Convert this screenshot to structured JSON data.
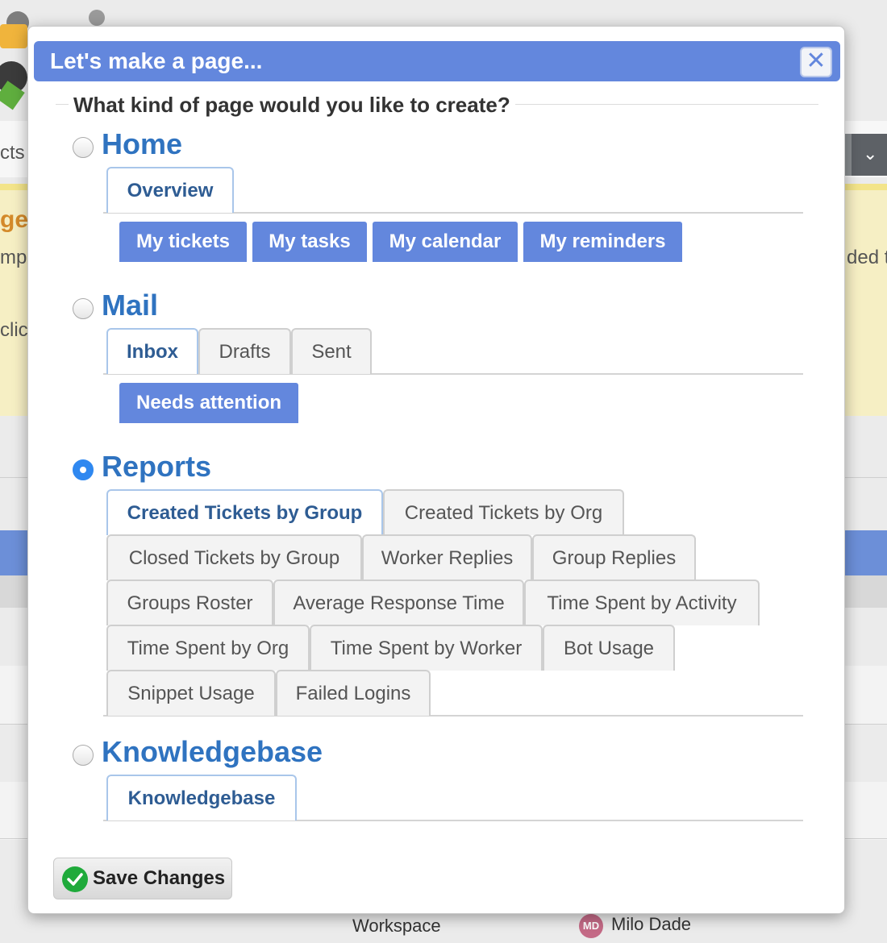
{
  "background": {
    "left_fragments": [
      "cts",
      "ge",
      "mpl",
      "clic"
    ],
    "right_fragment": "ded t",
    "footer": {
      "workspace_label": "Workspace",
      "avatar_initials": "MD",
      "user_name": "Milo Dade"
    }
  },
  "dialog": {
    "title": "Let's make a page...",
    "close_symbol": "✕",
    "question": "What kind of page would you like to create?",
    "selected_section": "Reports",
    "sections": {
      "home": {
        "label": "Home",
        "selected": false,
        "tabs": [
          "Overview"
        ],
        "active_tab": "Overview",
        "buttons": [
          "My tickets",
          "My tasks",
          "My calendar",
          "My reminders"
        ]
      },
      "mail": {
        "label": "Mail",
        "selected": false,
        "tabs": [
          "Inbox",
          "Drafts",
          "Sent"
        ],
        "active_tab": "Inbox",
        "buttons": [
          "Needs attention"
        ]
      },
      "reports": {
        "label": "Reports",
        "selected": true,
        "tabs": [
          "Created Tickets by Group",
          "Created Tickets by Org",
          "Closed Tickets by Group",
          "Worker Replies",
          "Group Replies",
          "Groups Roster",
          "Average Response Time",
          "Time Spent by Activity",
          "Time Spent by Org",
          "Time Spent by Worker",
          "Bot Usage",
          "Snippet Usage",
          "Failed Logins"
        ],
        "active_tab": "Created Tickets by Group"
      },
      "knowledgebase": {
        "label": "Knowledgebase",
        "selected": false,
        "tabs": [
          "Knowledgebase"
        ],
        "active_tab": "Knowledgebase"
      }
    },
    "save_button": {
      "label": "Save Changes",
      "icon": "check-circle-icon"
    }
  },
  "colors": {
    "title_bar": "#6387dd",
    "section_label": "#2f73c0",
    "radio_checked": "#2f88f0",
    "save_icon": "#1faa3b"
  }
}
